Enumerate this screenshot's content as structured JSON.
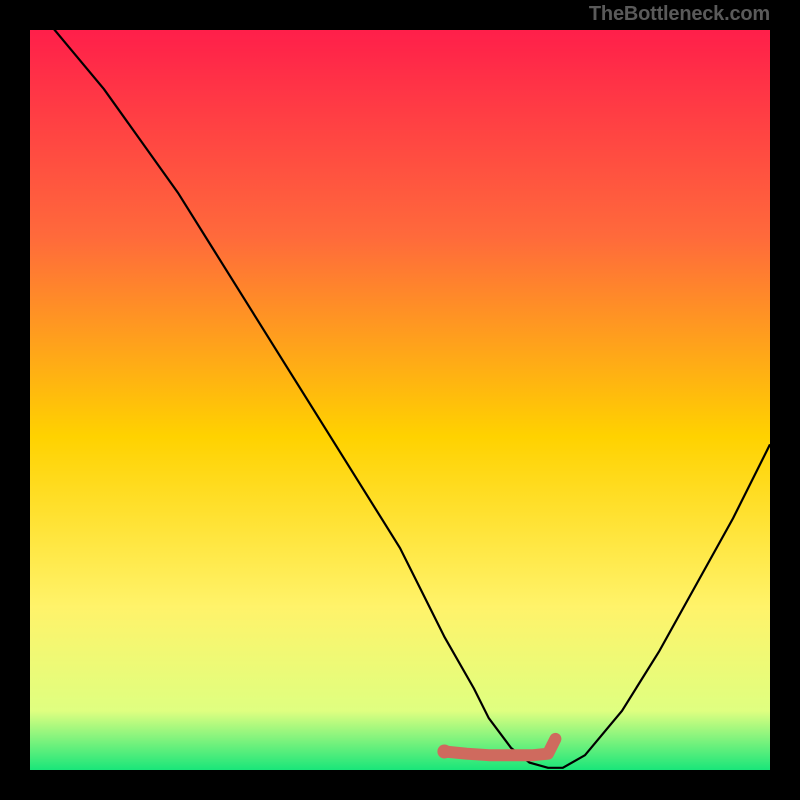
{
  "attribution": "TheBottleneck.com",
  "colors": {
    "gradient_top": "#ff1f4a",
    "gradient_upper_mid": "#ff6a3b",
    "gradient_mid": "#ffd200",
    "gradient_lower_mid": "#fff36a",
    "gradient_near_bottom": "#dfff80",
    "gradient_bottom_green": "#19e67a",
    "curve_stroke": "#000000",
    "marker_fill": "#cf6a5e",
    "background": "#000000"
  },
  "chart_data": {
    "type": "line",
    "title": "",
    "xlabel": "",
    "ylabel": "",
    "xlim": [
      0,
      100
    ],
    "ylim": [
      0,
      100
    ],
    "series": [
      {
        "name": "bottleneck-curve",
        "x": [
          0,
          5,
          10,
          15,
          20,
          25,
          30,
          35,
          40,
          45,
          50,
          53,
          56,
          60,
          62,
          65,
          67.5,
          70,
          72,
          75,
          80,
          85,
          90,
          95,
          100
        ],
        "values": [
          104,
          98,
          92,
          85,
          78,
          70,
          62,
          54,
          46,
          38,
          30,
          24,
          18,
          11,
          7,
          3,
          1,
          0.3,
          0.3,
          2,
          8,
          16,
          25,
          34,
          44
        ]
      }
    ],
    "markers": {
      "name": "optimal-range",
      "x": [
        56,
        59,
        62,
        65,
        68,
        70,
        71
      ],
      "values": [
        2.5,
        2.2,
        2.0,
        2.0,
        2.0,
        2.2,
        4.2
      ]
    },
    "annotations": [
      "TheBottleneck.com"
    ]
  }
}
